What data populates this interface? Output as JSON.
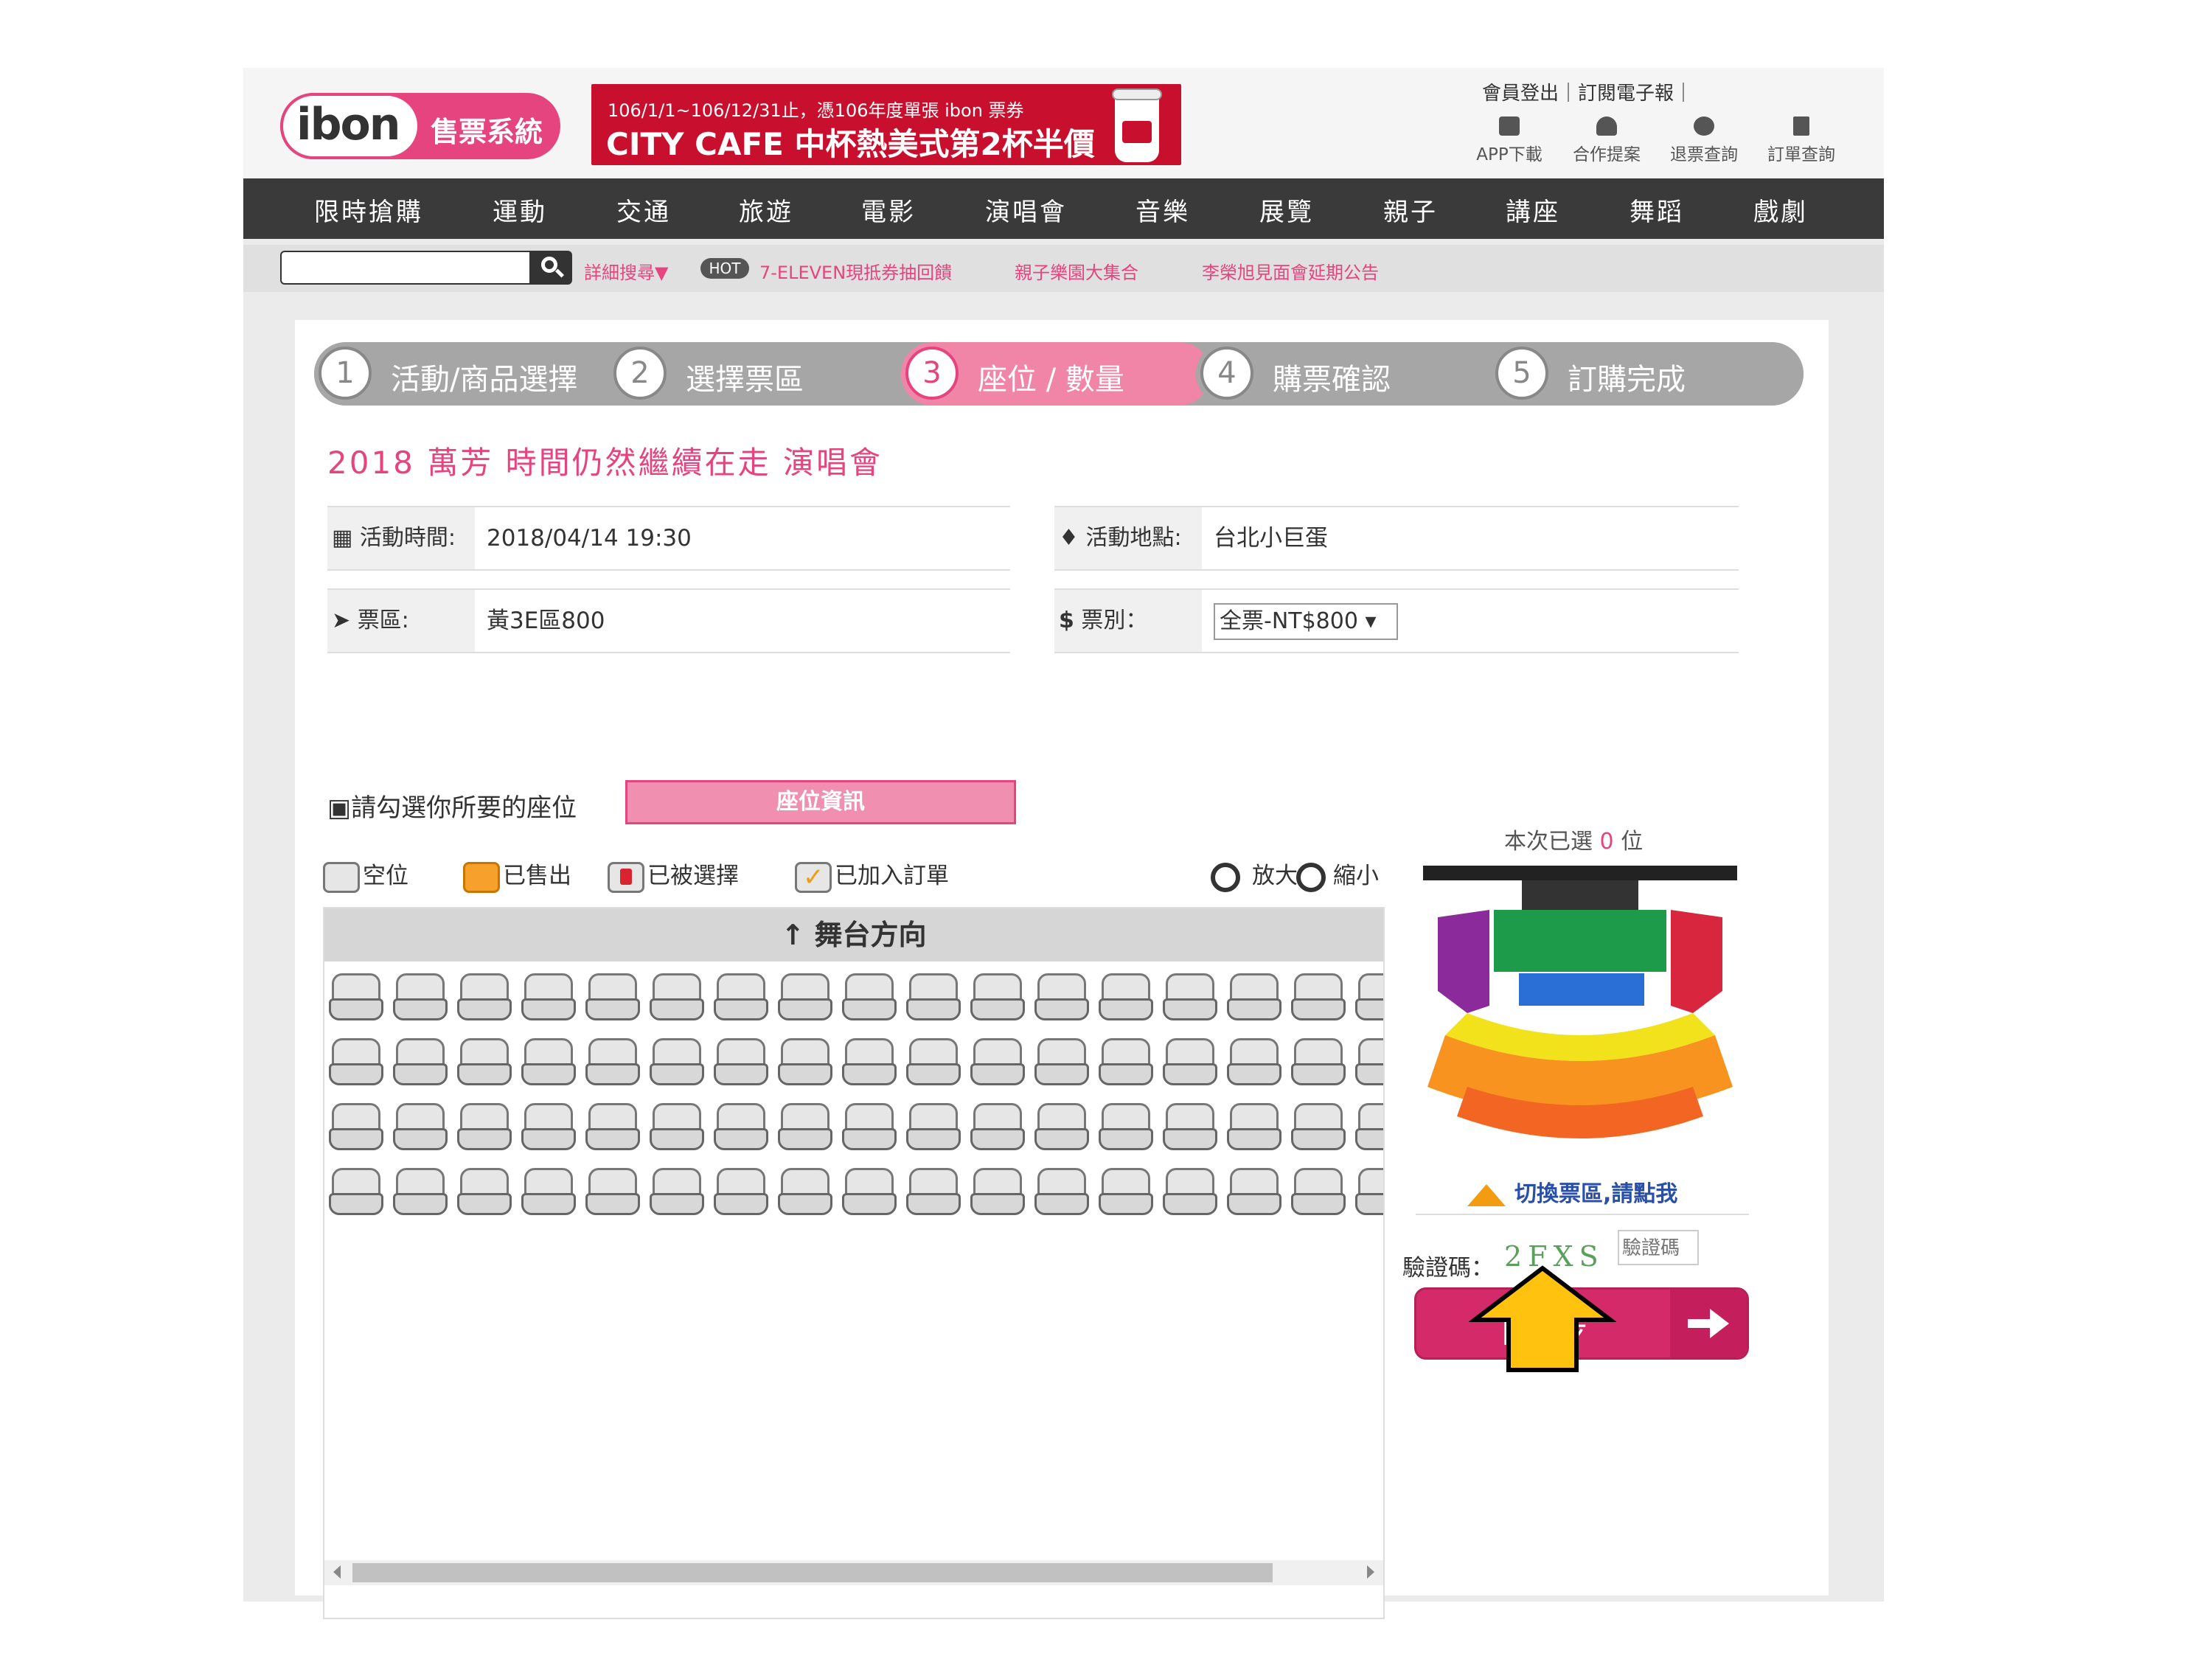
{
  "header": {
    "logo_text": "ibon",
    "system_label": "售票系統",
    "banner_line1": "106/1/1~106/12/31止，憑106年度單張 ibon 票券",
    "banner_line2": "CITY CAFE 中杯熱美式第2杯半價",
    "top_links": "會員登出｜訂閱電子報｜",
    "icon_links": [
      {
        "label": "APP下載",
        "icon": "phone-icon"
      },
      {
        "label": "合作提案",
        "icon": "car-icon"
      },
      {
        "label": "退票查詢",
        "icon": "refund-icon"
      },
      {
        "label": "訂單查詢",
        "icon": "document-icon"
      }
    ]
  },
  "nav": {
    "items": [
      "限時搶購",
      "運動",
      "交通",
      "旅遊",
      "電影",
      "演唱會",
      "音樂",
      "展覽",
      "親子",
      "講座",
      "舞蹈",
      "戲劇"
    ]
  },
  "search": {
    "placeholder": "",
    "advanced": "詳細搜尋▼",
    "hot_badge": "HOT",
    "links": [
      "7-ELEVEN現抵券抽回饋",
      "親子樂園大集合",
      "李榮旭見面會延期公告"
    ]
  },
  "steps": [
    {
      "num": "1",
      "label": "活動/商品選擇",
      "active": false
    },
    {
      "num": "2",
      "label": "選擇票區",
      "active": false
    },
    {
      "num": "3",
      "label": "座位 / 數量",
      "active": true
    },
    {
      "num": "4",
      "label": "購票確認",
      "active": false
    },
    {
      "num": "5",
      "label": "訂購完成",
      "active": false
    }
  ],
  "event": {
    "title": "2018 萬芳 時間仍然繼續在走 演唱會",
    "time_label": "活動時間:",
    "time_value": "2018/04/14 19:30",
    "place_label": "活動地點:",
    "place_value": "台北小巨蛋",
    "area_label": "票區:",
    "area_value": "黃3E區800",
    "type_label": "票別：",
    "type_value": "全票-NT$800 ▾"
  },
  "seat_section": {
    "pick_label": "請勾選你所要的座位",
    "seat_info_button": "座位資訊",
    "legend": {
      "empty": "空位",
      "sold": "已售出",
      "taken": "已被選擇",
      "ordered": "已加入訂單"
    },
    "zoom_in": "放大",
    "zoom_out": "縮小",
    "stage_label": "舞台方向",
    "rows": 4,
    "cols": 17
  },
  "right_panel": {
    "selected_prefix": "本次已選",
    "selected_count": "0",
    "selected_suffix": "位",
    "switch_link": "切換票區,請點我",
    "captcha_label": "驗證碼：",
    "captcha_text": "2FXS",
    "captcha_placeholder": "驗證碼",
    "next_button": "下一步"
  },
  "colors": {
    "brand_pink": "#e6447f",
    "nav_bg": "#3a3a3a",
    "step_active": "#f085a8",
    "step_inactive": "#a6a6a6",
    "next_button": "#d42a6a",
    "annotation_arrow": "#ffc20e"
  }
}
